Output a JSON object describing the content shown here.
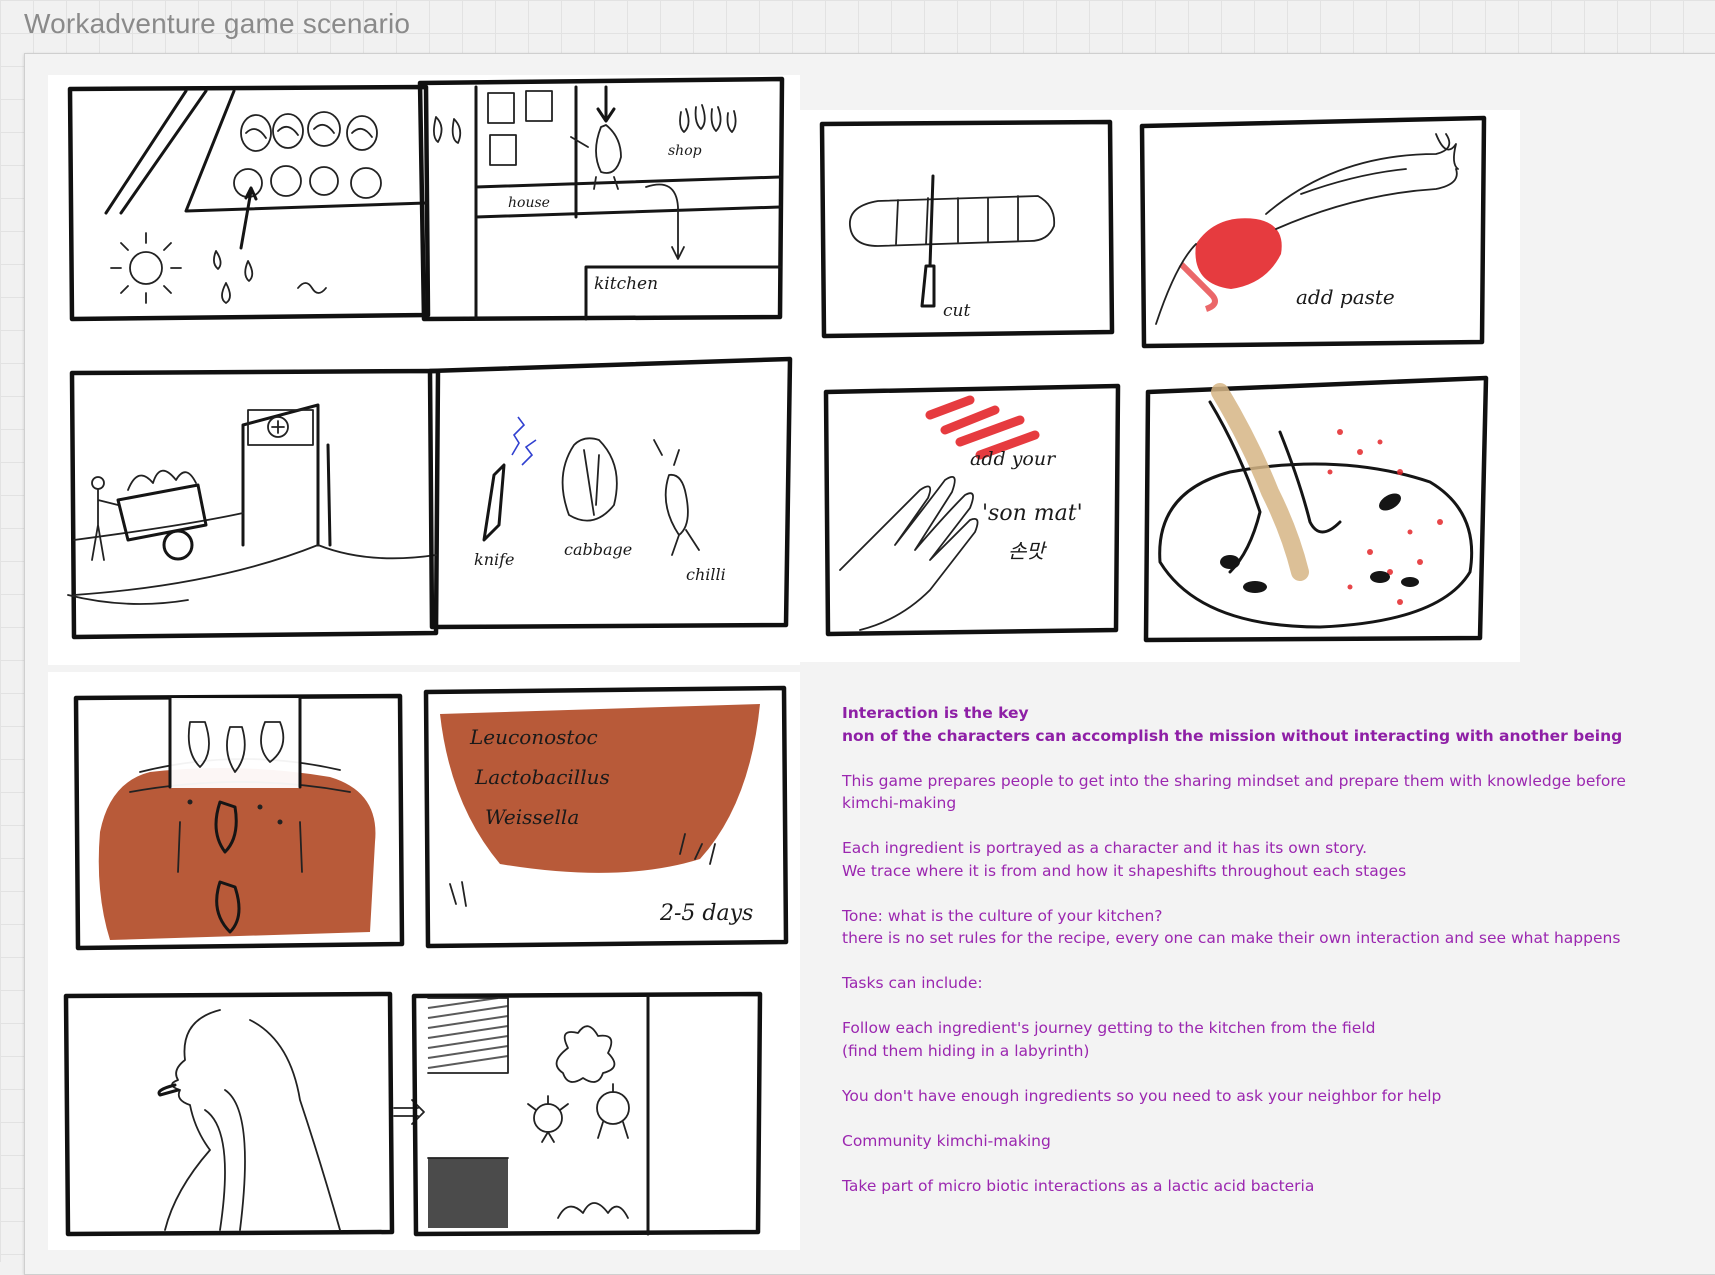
{
  "frame": {
    "title": "Workadventure game scenario"
  },
  "sketch_labels": {
    "shop": "shop",
    "house": "house",
    "kitchen": "kitchen",
    "cut": "cut",
    "add_paste": "add paste",
    "knife": "knife",
    "cabbage": "cabbage",
    "chilli": "chilli",
    "add_your": "add your",
    "son_mat": "'son mat'",
    "son_mat_korean": "손맛",
    "bacteria_1": "Leuconostoc",
    "bacteria_2": "Lactobacillus",
    "bacteria_3": "Weissella",
    "days": "2-5 days"
  },
  "notes": {
    "heading_1": "Interaction is the key",
    "heading_2": "non of the characters can accomplish the mission without interacting with another being",
    "p1_line1": "This game prepares people to get into the sharing mindset and prepare them with knowledge before",
    "p1_line2": "kimchi-making",
    "p2_line1": "Each ingredient is portrayed as a character and it has its own story.",
    "p2_line2": "We trace where it is from and how it shapeshifts throughout each stages",
    "p3_line1": "Tone: what is the culture of your kitchen?",
    "p3_line2": "there is no set rules for the recipe, every one can make their own interaction and see what happens",
    "p4": "Tasks can include:",
    "p5_line1": "Follow each ingredient's journey getting to the kitchen from the field",
    "p5_line2": "(find them hiding in a labyrinth)",
    "p6": "You don't have enough ingredients so you need to ask your neighbor for help",
    "p7": "Community kimchi-making",
    "p8": "Take part of micro biotic interactions as a lactic acid bacteria"
  },
  "colors": {
    "note_text": "#9b27b0",
    "note_heading": "#8e1fa6",
    "kimchi_red": "#e3262a",
    "onggi_brown": "#b4512e",
    "frame_title": "#8a8a8a"
  }
}
